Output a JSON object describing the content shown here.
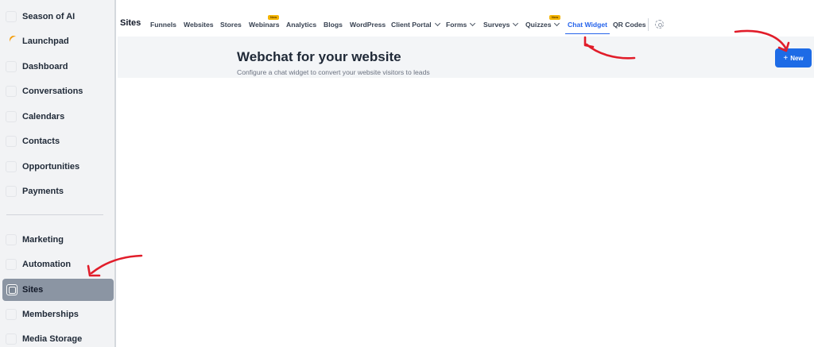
{
  "sidebar": {
    "items": [
      {
        "label": "Season of AI",
        "icon": "sparkle-icon"
      },
      {
        "label": "Launchpad",
        "icon": "launchpad-icon"
      },
      {
        "label": "Dashboard",
        "icon": "dashboard-icon"
      },
      {
        "label": "Conversations",
        "icon": "chat-icon"
      },
      {
        "label": "Calendars",
        "icon": "calendar-icon"
      },
      {
        "label": "Contacts",
        "icon": "contacts-icon"
      },
      {
        "label": "Opportunities",
        "icon": "opportunities-icon"
      },
      {
        "label": "Payments",
        "icon": "payments-icon"
      },
      {
        "label": "Marketing",
        "icon": "marketing-icon"
      },
      {
        "label": "Automation",
        "icon": "automation-icon"
      },
      {
        "label": "Sites",
        "icon": "sites-icon",
        "active": true
      },
      {
        "label": "Memberships",
        "icon": "memberships-icon"
      },
      {
        "label": "Media Storage",
        "icon": "media-icon"
      }
    ]
  },
  "topnav": {
    "title": "Sites",
    "tabs": [
      {
        "label": "Funnels"
      },
      {
        "label": "Websites"
      },
      {
        "label": "Stores"
      },
      {
        "label": "Webinars",
        "badge": "New"
      },
      {
        "label": "Analytics"
      },
      {
        "label": "Blogs"
      },
      {
        "label": "WordPress"
      },
      {
        "label": "Client Portal",
        "dropdown": true
      },
      {
        "label": "Forms",
        "dropdown": true
      },
      {
        "label": "Surveys",
        "dropdown": true
      },
      {
        "label": "Quizzes",
        "dropdown": true,
        "badge": "New"
      },
      {
        "label": "Chat Widget",
        "active": true
      },
      {
        "label": "QR Codes"
      }
    ],
    "settings_icon": "gear-icon"
  },
  "header": {
    "title": "Webchat for your website",
    "subtitle": "Configure a chat widget to convert your website visitors to leads",
    "new_button": {
      "label": "New",
      "icon": "plus-icon"
    }
  },
  "colors": {
    "accent": "#1d6be6",
    "annotation_arrow": "#e11d2a",
    "badge": "#f4b400",
    "active_sidebar": "#8b95a3"
  }
}
